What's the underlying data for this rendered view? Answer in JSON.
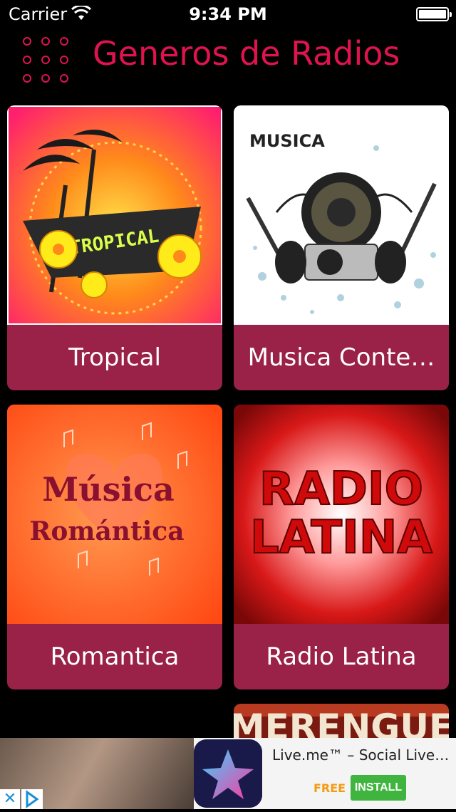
{
  "status": {
    "carrier": "Carrier",
    "time": "9:34 PM"
  },
  "header": {
    "title": "Generos de Radios"
  },
  "cards": [
    {
      "label": "Tropical",
      "image_text": "TROPICAL"
    },
    {
      "label": "Musica Conte…",
      "image_text": "MUSICA"
    },
    {
      "label": "Romantica",
      "image_text_1": "Música",
      "image_text_2": "Romántica"
    },
    {
      "label": "Radio Latina",
      "image_text_1": "RADIO",
      "image_text_2": "LATINA"
    }
  ],
  "partial_card": {
    "image_text": "MERENGUE"
  },
  "ad": {
    "app_name": "Live.me™ – Social Live…",
    "price": "FREE",
    "install_label": "INSTALL",
    "close_label": "✕"
  },
  "colors": {
    "accent": "#e0134f",
    "card_footer": "#9a2148",
    "background": "#000000",
    "install": "#3fb53f"
  }
}
